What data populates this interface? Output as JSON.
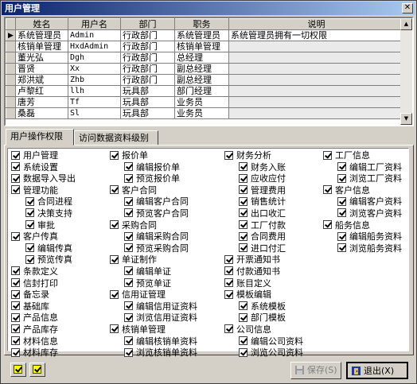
{
  "window": {
    "title": "用户管理",
    "close_glyph": "✕"
  },
  "grid": {
    "columns": [
      "姓名",
      "用户名",
      "部门",
      "职务",
      "说明"
    ],
    "rows": [
      [
        "系统管理员",
        "Admin",
        "行政部门",
        "系统管理员",
        "系统管理员拥有一切权限"
      ],
      [
        "核销单管理",
        "HxdAdmin",
        "行政部门",
        "核销单管理",
        ""
      ],
      [
        "董光弘",
        "Dgh",
        "行政部门",
        "总经理",
        ""
      ],
      [
        "晋贤",
        "Xx",
        "行政部门",
        "副总经理",
        ""
      ],
      [
        "郑洪斌",
        "Zhb",
        "行政部门",
        "副总经理",
        ""
      ],
      [
        "卢黎红",
        "llh",
        "玩具部",
        "部门经理",
        ""
      ],
      [
        "唐芳",
        "Tf",
        "玩具部",
        "业务员",
        ""
      ],
      [
        "桑磊",
        "Sl",
        "玩具部",
        "业务员",
        ""
      ]
    ],
    "current_row_marker": "▶"
  },
  "tabs": [
    "用户操作权限",
    "访问数据资料级别"
  ],
  "permissions": {
    "col1": [
      {
        "label": "用户管理",
        "level": 1
      },
      {
        "label": "系统设置",
        "level": 1
      },
      {
        "label": "数据导入导出",
        "level": 1
      },
      {
        "label": "管理功能",
        "level": 1
      },
      {
        "label": "合同进程",
        "level": 2
      },
      {
        "label": "决策支持",
        "level": 2
      },
      {
        "label": "审批",
        "level": 2
      },
      {
        "label": "客户传真",
        "level": 1
      },
      {
        "label": "编辑传真",
        "level": 2
      },
      {
        "label": "预览传真",
        "level": 2
      },
      {
        "label": "条款定义",
        "level": 1
      },
      {
        "label": "信封打印",
        "level": 1
      },
      {
        "label": "备忘录",
        "level": 1
      },
      {
        "label": "基础库",
        "level": 1
      },
      {
        "label": "产品信息",
        "level": 1
      },
      {
        "label": "产品库存",
        "level": 1
      },
      {
        "label": "材料信息",
        "level": 1
      },
      {
        "label": "材料库存",
        "level": 1
      }
    ],
    "col2": [
      {
        "label": "报价单",
        "level": 1
      },
      {
        "label": "编辑报价单",
        "level": 2
      },
      {
        "label": "预览报价单",
        "level": 2
      },
      {
        "label": "客户合同",
        "level": 1
      },
      {
        "label": "编辑客户合同",
        "level": 2
      },
      {
        "label": "预览客户合同",
        "level": 2
      },
      {
        "label": "采购合同",
        "level": 1
      },
      {
        "label": "编辑采购合同",
        "level": 2
      },
      {
        "label": "预览采购合同",
        "level": 2
      },
      {
        "label": "单证制作",
        "level": 1
      },
      {
        "label": "编辑单证",
        "level": 2
      },
      {
        "label": "预览单证",
        "level": 2
      },
      {
        "label": "信用证管理",
        "level": 1
      },
      {
        "label": "编辑信用证资料",
        "level": 2
      },
      {
        "label": "浏览信用证资料",
        "level": 2
      },
      {
        "label": "核销单管理",
        "level": 1
      },
      {
        "label": "编辑核销单资料",
        "level": 2
      },
      {
        "label": "浏览核销单资料",
        "level": 2
      }
    ],
    "col3": [
      {
        "label": "财务分析",
        "level": 1
      },
      {
        "label": "财务入账",
        "level": 2
      },
      {
        "label": "应收应付",
        "level": 2
      },
      {
        "label": "管理费用",
        "level": 2
      },
      {
        "label": "销售统计",
        "level": 2
      },
      {
        "label": "出口收汇",
        "level": 2
      },
      {
        "label": "工厂付款",
        "level": 2
      },
      {
        "label": "合同费用",
        "level": 2
      },
      {
        "label": "进口付汇",
        "level": 2
      },
      {
        "label": "开票通知书",
        "level": 1
      },
      {
        "label": "付款通知书",
        "level": 1
      },
      {
        "label": "账目定义",
        "level": 1
      },
      {
        "label": "模板编辑",
        "level": 1
      },
      {
        "label": "系统模板",
        "level": 2
      },
      {
        "label": "部门模板",
        "level": 2
      },
      {
        "label": "公司信息",
        "level": 1
      },
      {
        "label": "编辑公司资料",
        "level": 2
      },
      {
        "label": "浏览公司资料",
        "level": 2
      }
    ],
    "col4": [
      {
        "label": "工厂信息",
        "level": 1
      },
      {
        "label": "编辑工厂资料",
        "level": 2
      },
      {
        "label": "浏览工厂资料",
        "level": 2
      },
      {
        "label": "客户信息",
        "level": 1
      },
      {
        "label": "编辑客户资料",
        "level": 2
      },
      {
        "label": "浏览客户资料",
        "level": 2
      },
      {
        "label": "船务信息",
        "level": 1
      },
      {
        "label": "编辑船务资料",
        "level": 2
      },
      {
        "label": "浏览船务资料",
        "level": 2
      }
    ]
  },
  "buttons": {
    "save": "保存(S)",
    "exit": "退出(X)"
  },
  "colors": {
    "title_start": "#0a246a",
    "title_end": "#a6caf0",
    "face": "#d4d0c8",
    "check_select_all": "#ffff00"
  },
  "icons": {
    "save": "floppy-icon",
    "exit": "exit-door-icon",
    "close": "close-icon"
  }
}
